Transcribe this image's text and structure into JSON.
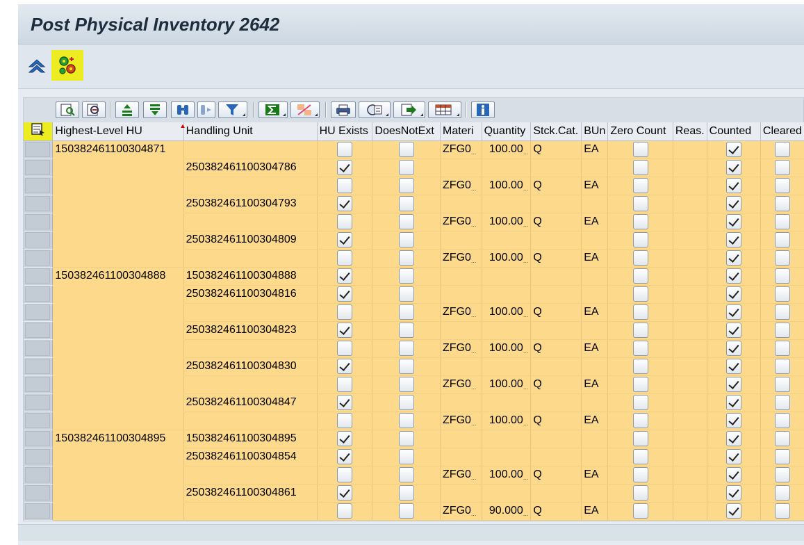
{
  "window": {
    "title": "Post Physical Inventory 2642"
  },
  "app_toolbar": {
    "up_icon": "navigate-up-icon",
    "execute_icon": "execute-gears-icon"
  },
  "alv_toolbar": {
    "buttons": [
      "details-icon",
      "find-icon",
      "sort-ascending-icon",
      "sort-descending-icon",
      "search-icon",
      "find-next-icon",
      "filter-icon",
      "total-icon",
      "subtotal-icon",
      "print-preview-icon",
      "change-layout-icon",
      "export-icon",
      "select-layout-icon",
      "information-icon"
    ]
  },
  "columns": [
    "Highest-Level HU",
    "Handling Unit",
    "HU Exists",
    "DoesNotExt",
    "Materi",
    "Quantity",
    "Stck.Cat.",
    "BUn",
    "Zero Count",
    "Reas.",
    "Counted",
    "Cleared"
  ],
  "rows": [
    {
      "highest_hu": "150382461100304871",
      "hu": "",
      "hu_exists": false,
      "material": "ZFG0",
      "quantity": "100.00",
      "stock_cat": "Q",
      "bun": "EA"
    },
    {
      "highest_hu": "",
      "hu": "250382461100304786",
      "hu_exists": true,
      "material": "",
      "quantity": "",
      "stock_cat": "",
      "bun": ""
    },
    {
      "highest_hu": "",
      "hu": "",
      "hu_exists": false,
      "material": "ZFG0",
      "quantity": "100.00",
      "stock_cat": "Q",
      "bun": "EA"
    },
    {
      "highest_hu": "",
      "hu": "250382461100304793",
      "hu_exists": true,
      "material": "",
      "quantity": "",
      "stock_cat": "",
      "bun": ""
    },
    {
      "highest_hu": "",
      "hu": "",
      "hu_exists": false,
      "material": "ZFG0",
      "quantity": "100.00",
      "stock_cat": "Q",
      "bun": "EA"
    },
    {
      "highest_hu": "",
      "hu": "250382461100304809",
      "hu_exists": true,
      "material": "",
      "quantity": "",
      "stock_cat": "",
      "bun": ""
    },
    {
      "highest_hu": "",
      "hu": "",
      "hu_exists": false,
      "material": "ZFG0",
      "quantity": "100.00",
      "stock_cat": "Q",
      "bun": "EA"
    },
    {
      "highest_hu": "150382461100304888",
      "hu": "150382461100304888",
      "hu_exists": true,
      "material": "",
      "quantity": "",
      "stock_cat": "",
      "bun": ""
    },
    {
      "highest_hu": "",
      "hu": "250382461100304816",
      "hu_exists": true,
      "material": "",
      "quantity": "",
      "stock_cat": "",
      "bun": ""
    },
    {
      "highest_hu": "",
      "hu": "",
      "hu_exists": false,
      "material": "ZFG0",
      "quantity": "100.00",
      "stock_cat": "Q",
      "bun": "EA"
    },
    {
      "highest_hu": "",
      "hu": "250382461100304823",
      "hu_exists": true,
      "material": "",
      "quantity": "",
      "stock_cat": "",
      "bun": ""
    },
    {
      "highest_hu": "",
      "hu": "",
      "hu_exists": false,
      "material": "ZFG0",
      "quantity": "100.00",
      "stock_cat": "Q",
      "bun": "EA"
    },
    {
      "highest_hu": "",
      "hu": "250382461100304830",
      "hu_exists": true,
      "material": "",
      "quantity": "",
      "stock_cat": "",
      "bun": ""
    },
    {
      "highest_hu": "",
      "hu": "",
      "hu_exists": false,
      "material": "ZFG0",
      "quantity": "100.00",
      "stock_cat": "Q",
      "bun": "EA"
    },
    {
      "highest_hu": "",
      "hu": "250382461100304847",
      "hu_exists": true,
      "material": "",
      "quantity": "",
      "stock_cat": "",
      "bun": ""
    },
    {
      "highest_hu": "",
      "hu": "",
      "hu_exists": false,
      "material": "ZFG0",
      "quantity": "100.00",
      "stock_cat": "Q",
      "bun": "EA"
    },
    {
      "highest_hu": "150382461100304895",
      "hu": "150382461100304895",
      "hu_exists": true,
      "material": "",
      "quantity": "",
      "stock_cat": "",
      "bun": ""
    },
    {
      "highest_hu": "",
      "hu": "250382461100304854",
      "hu_exists": true,
      "material": "",
      "quantity": "",
      "stock_cat": "",
      "bun": ""
    },
    {
      "highest_hu": "",
      "hu": "",
      "hu_exists": false,
      "material": "ZFG0",
      "quantity": "100.00",
      "stock_cat": "Q",
      "bun": "EA"
    },
    {
      "highest_hu": "",
      "hu": "250382461100304861",
      "hu_exists": true,
      "material": "",
      "quantity": "",
      "stock_cat": "",
      "bun": ""
    },
    {
      "highest_hu": "",
      "hu": "",
      "hu_exists": false,
      "material": "ZFG0",
      "quantity": "90.000",
      "stock_cat": "Q",
      "bun": "EA"
    }
  ],
  "colors": {
    "row_bg": "#fcd98b",
    "highlight": "#ecec20",
    "header_bg": "#e9edf1"
  }
}
